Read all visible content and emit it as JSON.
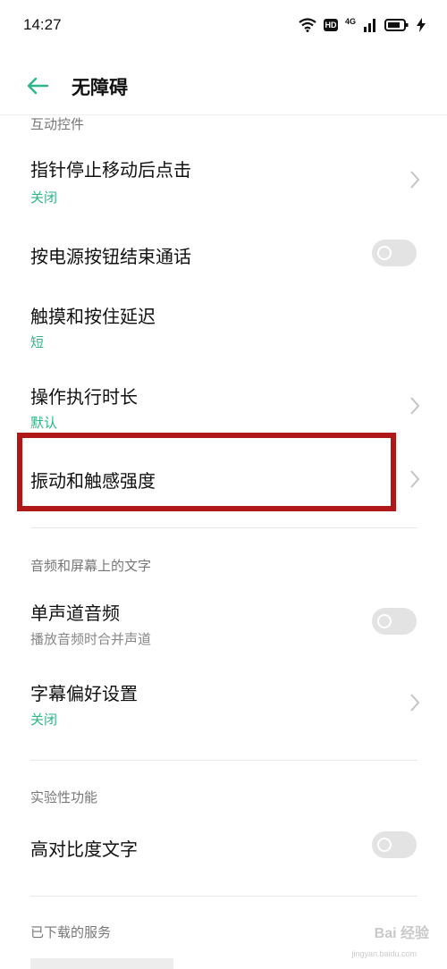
{
  "status_bar": {
    "time": "14:27",
    "hd": "HD",
    "network": "4G",
    "icons": [
      "wifi-icon",
      "hd-icon",
      "signal-icon",
      "battery-icon",
      "charging-icon"
    ]
  },
  "header": {
    "title": "无障碍",
    "back_icon": "arrow-left-icon",
    "accent_color": "#2fb586"
  },
  "sections": [
    {
      "title": "互动控件"
    },
    {
      "title": "音频和屏幕上的文字"
    },
    {
      "title": "实验性功能"
    },
    {
      "title": "已下载的服务"
    }
  ],
  "rows": [
    {
      "title": "指针停止移动后点击",
      "subtitle": "关闭",
      "control": "chevron"
    },
    {
      "title": "按电源按钮结束通话",
      "control": "toggle",
      "checked": false
    },
    {
      "title": "触摸和按住延迟",
      "subtitle": "短",
      "control": "none"
    },
    {
      "title": "操作执行时长",
      "subtitle": "默认",
      "control": "chevron"
    },
    {
      "title": "振动和触感强度",
      "control": "chevron",
      "highlighted": true
    },
    {
      "title": "单声道音频",
      "subtitle": "播放音频时合并声道",
      "control": "toggle",
      "checked": false
    },
    {
      "title": "字幕偏好设置",
      "subtitle": "关闭",
      "control": "chevron"
    },
    {
      "title": "高对比度文字",
      "control": "toggle",
      "checked": false
    }
  ],
  "highlight_color": "#b01818",
  "watermark": {
    "text": "Bai 经验",
    "subtext": "jingyan.baidu.com"
  }
}
